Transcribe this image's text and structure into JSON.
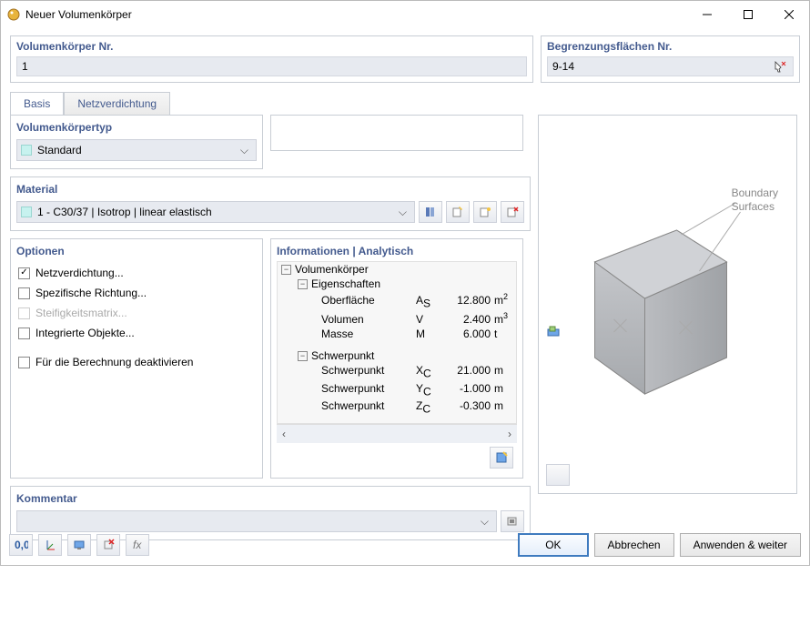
{
  "window": {
    "title": "Neuer Volumenkörper"
  },
  "header": {
    "nr_label": "Volumenkörper Nr.",
    "nr_value": "1",
    "boundary_label": "Begrenzungsflächen Nr.",
    "boundary_value": "9-14"
  },
  "tabs": {
    "basis": "Basis",
    "mesh": "Netzverdichtung"
  },
  "type": {
    "label": "Volumenkörpertyp",
    "value": "Standard"
  },
  "material": {
    "label": "Material",
    "value": "1 - C30/37 | Isotrop | linear elastisch"
  },
  "options": {
    "label": "Optionen",
    "mesh": "Netzverdichtung...",
    "specdir": "Spezifische Richtung...",
    "stiffness": "Steifigkeitsmatrix...",
    "integrated": "Integrierte Objekte...",
    "deactivate": "Für die Berechnung deaktivieren"
  },
  "info": {
    "title": "Informationen | Analytisch",
    "solid": "Volumenkörper",
    "props": "Eigenschaften",
    "centroid": "Schwerpunkt",
    "rows": {
      "surface": {
        "name": "Oberfläche",
        "sym": "A",
        "sub": "S",
        "val": "12.800",
        "unit": "m",
        "exp": "2"
      },
      "volume": {
        "name": "Volumen",
        "sym": "V",
        "sub": "",
        "val": "2.400",
        "unit": "m",
        "exp": "3"
      },
      "mass": {
        "name": "Masse",
        "sym": "M",
        "sub": "",
        "val": "6.000",
        "unit": "t",
        "exp": ""
      },
      "xc": {
        "name": "Schwerpunkt",
        "sym": "X",
        "sub": "C",
        "val": "21.000",
        "unit": "m"
      },
      "yc": {
        "name": "Schwerpunkt",
        "sym": "Y",
        "sub": "C",
        "val": "-1.000",
        "unit": "m"
      },
      "zc": {
        "name": "Schwerpunkt",
        "sym": "Z",
        "sub": "C",
        "val": "-0.300",
        "unit": "m"
      }
    }
  },
  "preview": {
    "label1": "Boundary",
    "label2": "Surfaces"
  },
  "comment": {
    "label": "Kommentar",
    "value": ""
  },
  "buttons": {
    "ok": "OK",
    "cancel": "Abbrechen",
    "apply": "Anwenden & weiter"
  }
}
